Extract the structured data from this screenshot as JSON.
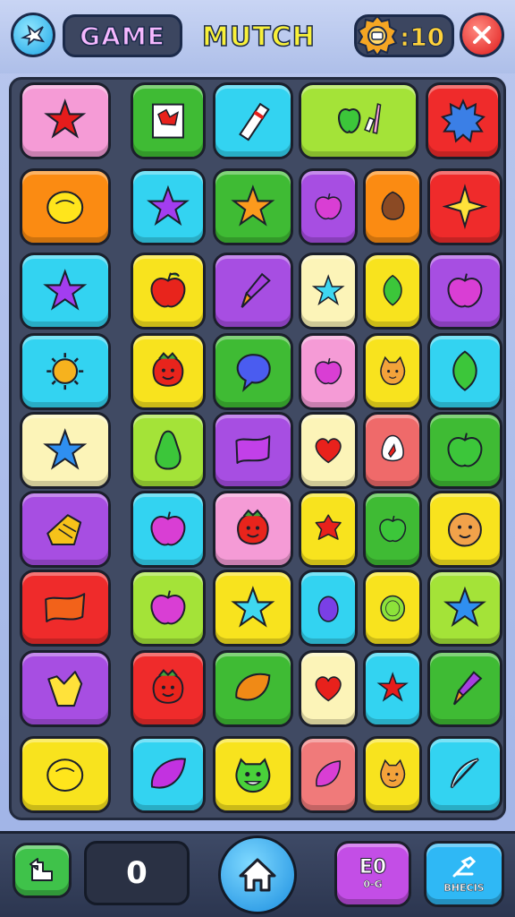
{
  "header": {
    "title_left": "GAME",
    "title_right": "MUTCH",
    "score": ":10",
    "logo_icon": "bird-icon",
    "coin_icon": "gear-coin-icon",
    "close_icon": "close-icon"
  },
  "board": {
    "rows": [
      [
        "red-star",
        "book-picture",
        "eraser",
        "apple-pencil-combo",
        "blue-starburst"
      ],
      [
        "yellow-lemon",
        "purple-star",
        "orange-star",
        "magenta-apple",
        "brown-nut",
        "yellow-sparkle"
      ],
      [
        "purple-star",
        "red-apple",
        "paint-brush",
        "teal-star",
        "green-leaf",
        "magenta-apple"
      ],
      [
        "orange-sun",
        "red-strawberry-face",
        "blue-speech-bubble",
        "magenta-apple",
        "cat-face",
        "green-leaf"
      ],
      [
        "blue-star",
        "green-pear",
        "purple-cloud",
        "red-heart",
        "white-egg",
        "green-apple"
      ],
      [
        "yellow-pasta",
        "magenta-apple",
        "red-strawberry-face",
        "red-blob-star",
        "green-apple",
        "monkey-face"
      ],
      [
        "orange-wave",
        "magenta-apple",
        "teal-star",
        "purple-plum",
        "green-lime",
        "blue-star"
      ],
      [
        "yellow-bird",
        "red-strawberry-face",
        "orange-leaf",
        "red-heart",
        "red-star",
        "paint-brush"
      ],
      [
        "yellow-lemon",
        "purple-leaf",
        "green-monster-face",
        "pink-leaf",
        "cat-face",
        "white-bow"
      ]
    ]
  },
  "footer": {
    "back_icon": "back-arrow-icon",
    "counter_value": "0",
    "home_icon": "home-icon",
    "stats_big": "E0",
    "stats_caption": "0-G",
    "skills_caption": "BHECIS",
    "skills_icon": "tool-icon"
  },
  "colors": {
    "board_bg": "#404a63",
    "tile_red": "#ef2b2b",
    "tile_green": "#3fbb34",
    "tile_cyan": "#33d3f1",
    "tile_yellow": "#f8e31e",
    "tile_pink": "#f59bd6",
    "tile_orange": "#fb8b12",
    "tile_purple": "#a74ee2",
    "tile_lime": "#a4e338",
    "tile_cream": "#fcf4b8"
  }
}
